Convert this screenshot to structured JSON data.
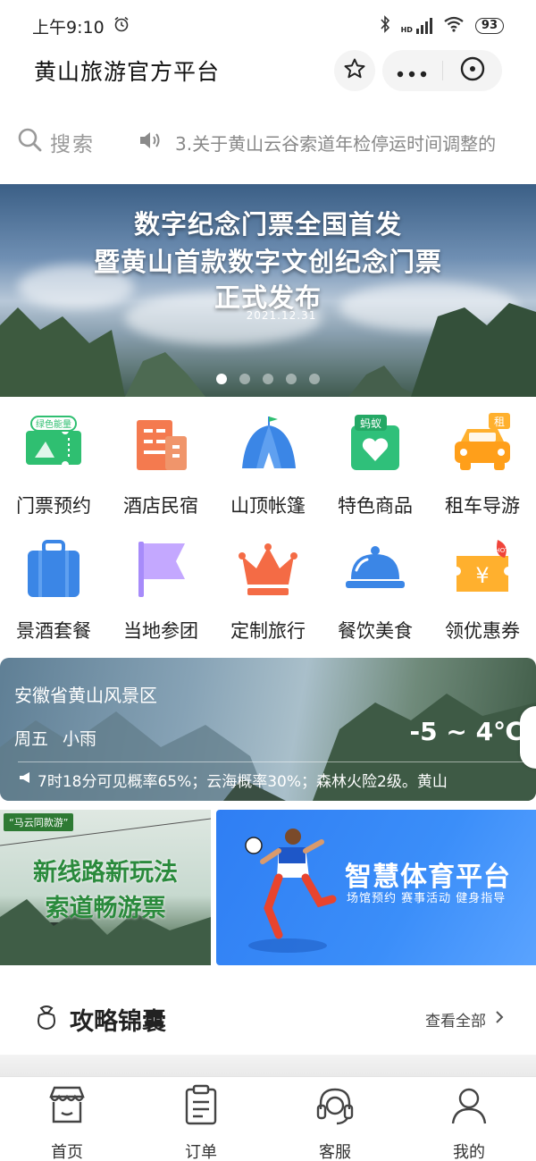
{
  "status": {
    "time": "上午9:10",
    "battery": "93",
    "net": "HD"
  },
  "header": {
    "title": "黄山旅游官方平台"
  },
  "search": {
    "placeholder": "搜索",
    "notice": "3.关于黄山云谷索道年检停运时间调整的"
  },
  "banner": {
    "line1": "数字纪念门票全国首发",
    "line2": "暨黄山首款数字文创纪念门票",
    "line3": "正式发布",
    "date": "2021.12.31",
    "dots": 5,
    "active_dot": 1
  },
  "services": [
    {
      "label": "门票预约",
      "icon": "ticket-icon",
      "badge": "绿色能量"
    },
    {
      "label": "酒店民宿",
      "icon": "hotel-icon"
    },
    {
      "label": "山顶帐篷",
      "icon": "tent-icon"
    },
    {
      "label": "特色商品",
      "icon": "heart-bag-icon",
      "badge": "蚂蚁"
    },
    {
      "label": "租车导游",
      "icon": "car-icon",
      "badge": "租"
    },
    {
      "label": "景酒套餐",
      "icon": "suitcase-icon"
    },
    {
      "label": "当地参团",
      "icon": "flag-icon"
    },
    {
      "label": "定制旅行",
      "icon": "crown-icon"
    },
    {
      "label": "餐饮美食",
      "icon": "food-dome-icon"
    },
    {
      "label": "领优惠券",
      "icon": "coupon-icon",
      "badge": "HOT"
    }
  ],
  "weather": {
    "place": "安徽省黄山风景区",
    "day": "周五",
    "condition": "小雨",
    "temp": "-5 ~ 4℃",
    "ticker": "7时18分可见概率65%；云海概率30%；森林火险2级。黄山"
  },
  "promo_left": {
    "tag": "“马云同款游”",
    "line1": "新线路新玩法",
    "line2": "索道畅游票"
  },
  "promo_right": {
    "title": "智慧体育平台",
    "sub": "场馆预约  赛事活动  健身指导"
  },
  "section": {
    "title": "攻略锦囊",
    "more": "查看全部"
  },
  "tabs": [
    {
      "label": "首页",
      "icon": "store-icon"
    },
    {
      "label": "订单",
      "icon": "clipboard-icon"
    },
    {
      "label": "客服",
      "icon": "headset-icon"
    },
    {
      "label": "我的",
      "icon": "user-icon"
    }
  ],
  "colors": {
    "green": "#2fbf71",
    "orange": "#f46b45",
    "blue": "#3b82f6",
    "tab_text": "#333333"
  }
}
